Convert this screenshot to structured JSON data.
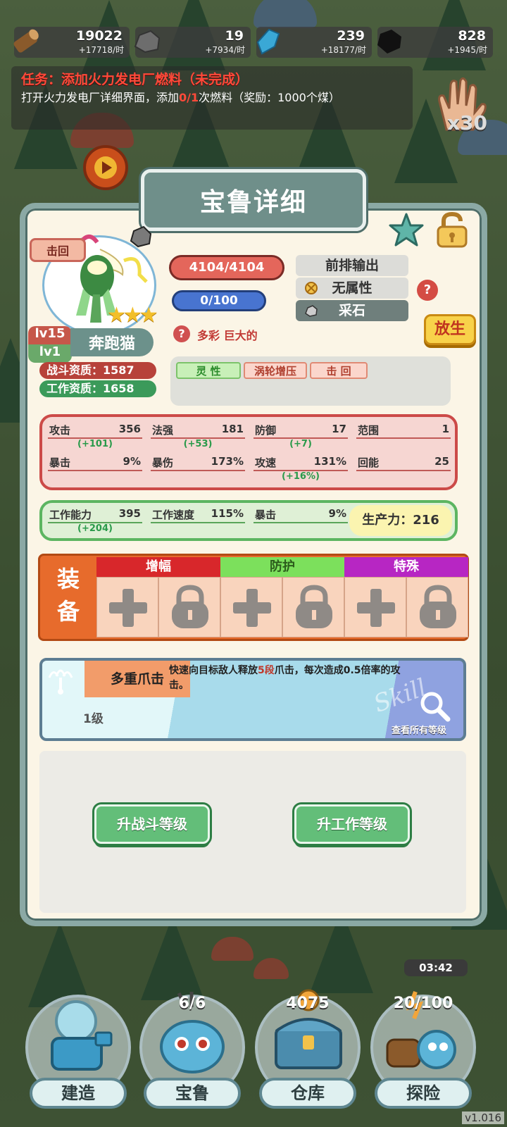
{
  "resources": [
    {
      "icon": "wood-log-icon",
      "value": "19022",
      "rate": "+17718/时"
    },
    {
      "icon": "stone-icon",
      "value": "19",
      "rate": "+7934/时"
    },
    {
      "icon": "crystal-icon",
      "value": "239",
      "rate": "+18177/时"
    },
    {
      "icon": "coal-icon",
      "value": "828",
      "rate": "+1945/时"
    }
  ],
  "task": {
    "title": "任务：添加火力发电厂燃料（未完成）",
    "desc_pre": "打开火力发电厂详细界面，添加",
    "progress": "0/1",
    "desc_post": "次燃料（奖励：1000个煤）"
  },
  "multiplier": "x30",
  "panel": {
    "title": "宝鲁详细",
    "pet": {
      "skill_tag": "击回",
      "level_combat": "lv15",
      "level_work": "lv1",
      "name": "奔跑猫",
      "stars": "★★★",
      "combat_aptitude": "战斗资质：1587",
      "work_aptitude": "工作资质：1658",
      "hp": "4104/4104",
      "mp": "0/100",
      "traits_line": "多彩 巨大的",
      "roles": [
        "前排输出",
        "无属性",
        "采石"
      ],
      "release_label": "放生",
      "tags": [
        "灵 性",
        "涡轮增压",
        "击 回"
      ]
    },
    "combat_stats": [
      {
        "key": "攻击",
        "val": "356",
        "bonus": "(+101)"
      },
      {
        "key": "法强",
        "val": "181",
        "bonus": "(+53)"
      },
      {
        "key": "防御",
        "val": "17",
        "bonus": "(+7)"
      },
      {
        "key": "范围",
        "val": "1",
        "bonus": ""
      },
      {
        "key": "暴击",
        "val": "9%",
        "bonus": ""
      },
      {
        "key": "暴伤",
        "val": "173%",
        "bonus": ""
      },
      {
        "key": "攻速",
        "val": "131%",
        "bonus": "(+16%)"
      },
      {
        "key": "回能",
        "val": "25",
        "bonus": ""
      }
    ],
    "work_stats": [
      {
        "key": "工作能力",
        "val": "395",
        "bonus": "(+204)"
      },
      {
        "key": "工作速度",
        "val": "115%",
        "bonus": ""
      },
      {
        "key": "暴击",
        "val": "9%",
        "bonus": ""
      }
    ],
    "productivity": "生产力：216",
    "equipment": {
      "label_1": "装",
      "label_2": "备",
      "groups": [
        "增幅",
        "防护",
        "特殊"
      ]
    },
    "skill": {
      "name": "多重爪击",
      "level": "1级",
      "desc_1": "快速向目标敌人释放",
      "desc_hl": "5段",
      "desc_2": "爪击，每次造成0.5倍率的攻击。",
      "watermark": "Skill",
      "see_all": "查看所有等级"
    },
    "buttons": {
      "upgrade_combat": "升战斗等级",
      "upgrade_work": "升工作等级"
    }
  },
  "nav": [
    {
      "label": "建造",
      "count": ""
    },
    {
      "label": "宝鲁",
      "count": "6/6"
    },
    {
      "label": "仓库",
      "count": "4075"
    },
    {
      "label": "探险",
      "count": "20/100"
    }
  ],
  "explore_timer": "03:42",
  "version": "v1.016",
  "colors": {
    "panel_border": "#8ba9a5",
    "hp": "#e4665b",
    "mp": "#4874d0",
    "release": "#f8d24a"
  }
}
